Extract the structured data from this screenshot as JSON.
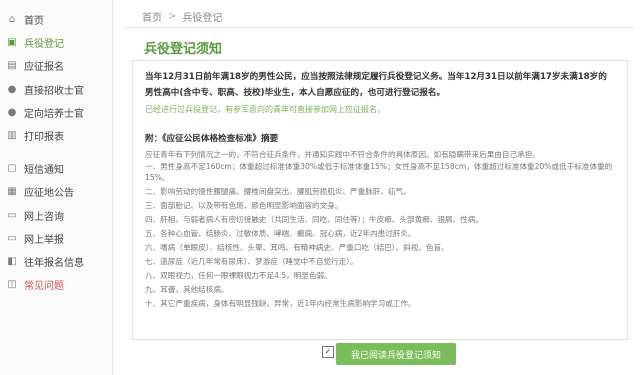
{
  "sidebar": {
    "items": [
      {
        "label": "首页",
        "icon": "home-icon"
      },
      {
        "label": "兵役登记",
        "icon": "register-icon"
      },
      {
        "label": "应征报名",
        "icon": "form-icon"
      },
      {
        "label": "直接招收士官",
        "icon": "person-icon"
      },
      {
        "label": "定向培养士官",
        "icon": "person-icon"
      },
      {
        "label": "打印报表",
        "icon": "printer-icon"
      },
      {
        "label": "短信通知",
        "icon": "message-icon"
      },
      {
        "label": "应征地公告",
        "icon": "notice-icon"
      },
      {
        "label": "网上咨询",
        "icon": "chat-icon"
      },
      {
        "label": "网上举报",
        "icon": "report-icon"
      },
      {
        "label": "往年报名信息",
        "icon": "history-icon"
      },
      {
        "label": "常见问题",
        "icon": "help-icon"
      }
    ]
  },
  "breadcrumb": {
    "home": "首页",
    "sep": ">",
    "current": "兵役登记"
  },
  "page_title": "兵役登记须知",
  "notice": {
    "lead": "当年12月31日前年满18岁的男性公民，应当按照法律规定履行兵役登记义务。当年12月31日以前年满17岁未满18岁的男性高中(含中专、职高、技校)毕业生，本人自愿应征的，也可进行登记报名。",
    "hint": "已经进行过兵役登记，有参军意向的青年可直接参加网上应征报名。",
    "section_title": "附：《应征公民体格检查标准》摘要",
    "items": [
      "应征青年有下列情况之一的，不符合征兵条件，并通知实践中不符合条件的具体原因。如有隐瞒带来后果由自己承担。",
      "一、男性身高不足160cm；体重超过标准体重30%或低于标准体重15%；女性身高不足158cm，体重超过标准体重20%或低于标准体重的15%。",
      "二、影响劳动的慢性腰腿痛、腰椎间盘突出、腰肌劳损肌炎、严重脉肝、疝气。",
      "三、面部胎记、以及带有色斑、颜色明显影响面容的文身。",
      "四、肝相、与弱者病人有密切接触史（共同生活、同吃、同住等）；牛皮癣、头部黄癣、银屑、性病。",
      "五、各种心血管、结肠炎、过敏体质、哮喘、癫痫、冠心病，近2年内患过肝炎。",
      "六、嗜病（单眼皮）、结核性、头晕、耳鸣、有精神病史、严重口吃（结巴）、斜视、色盲。",
      "七、遗尿症（近几年常有尿床）、梦游症（睡觉中不自觉行走）。",
      "八、双眼视力，任何一眼裸眼视力不足4.5，明显色弱。",
      "九、耳聋，其他结核病。",
      "十、其它严重疾病，身体有明显残缺、异常，近1年内经常生病影响学习或工作。"
    ]
  },
  "footer": {
    "checkbox_mark": "✓",
    "button_label": "我已阅读兵役登记须知"
  },
  "colors": {
    "accent": "#5a9a3a",
    "button": "#7bbd5a",
    "danger": "#d9534f"
  }
}
